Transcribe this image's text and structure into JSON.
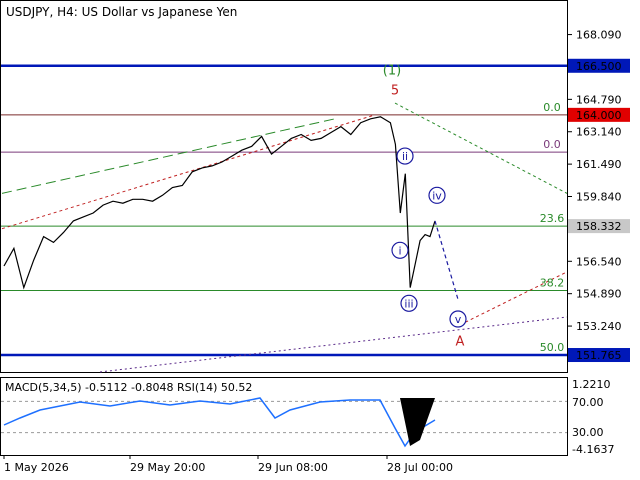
{
  "header": {
    "symbol": "USDJPY",
    "timeframe": "H4",
    "description": "US Dollar vs Japanese Yen",
    "title_text": "USDJPY, H4:  US Dollar vs Japanese Yen"
  },
  "chart_data": {
    "type": "line",
    "title": "USDJPY, H4:  US Dollar vs Japanese Yen",
    "price_ylim": [
      150.9,
      169.8
    ],
    "y_tick_labels": [
      "168.090",
      "166.500",
      "164.790",
      "164.000",
      "163.140",
      "161.490",
      "159.840",
      "158.332",
      "156.540",
      "154.890",
      "153.240",
      "151.765"
    ],
    "y_ticks": [
      168.09,
      164.79,
      163.14,
      161.49,
      159.84,
      156.54,
      154.89,
      153.24
    ],
    "x_tick_labels": [
      "1 May 2026",
      "29 May 20:00",
      "29 Jun 08:00",
      "28 Jul 00:00"
    ],
    "price_series": {
      "name": "USDJPY",
      "x": [
        0,
        10,
        20,
        30,
        40,
        50,
        60,
        70,
        80,
        90,
        100,
        110,
        120,
        130,
        140,
        150,
        160,
        170,
        180,
        190,
        200,
        210,
        220,
        230,
        240,
        250,
        260,
        270,
        280,
        290,
        300,
        310,
        320,
        330,
        340,
        350,
        360,
        370,
        380,
        390,
        395,
        400,
        405,
        410,
        415,
        420,
        425,
        430,
        435
      ],
      "y": [
        156.3,
        157.2,
        155.2,
        156.6,
        157.8,
        157.5,
        158.0,
        158.6,
        158.8,
        159.0,
        159.4,
        159.6,
        159.5,
        159.7,
        159.7,
        159.6,
        159.9,
        160.3,
        160.4,
        161.1,
        161.3,
        161.4,
        161.6,
        161.9,
        162.2,
        162.4,
        162.9,
        162.0,
        162.4,
        162.8,
        163.0,
        162.7,
        162.8,
        163.1,
        163.4,
        163.0,
        163.6,
        163.8,
        163.9,
        163.6,
        162.5,
        159.0,
        161.0,
        155.2,
        156.4,
        157.6,
        157.9,
        157.8,
        158.6
      ]
    },
    "levels": [
      {
        "price": 166.5,
        "label": "166.500",
        "color": "#0018b8",
        "style": "thick"
      },
      {
        "price": 164.0,
        "label": "164.000",
        "color": "#7a2b2b",
        "style": "solid",
        "badge_color": "#e00000"
      },
      {
        "price": 162.1,
        "label": "0.0",
        "color": "#7a3a7a",
        "style": "solid"
      },
      {
        "price": 158.332,
        "label": "158.332",
        "color": "#2a8a2a",
        "style": "solid",
        "badge_color": "#c8c8c8"
      },
      {
        "price": 155.05,
        "label": "38.2",
        "color": "#2a8a2a",
        "style": "solid"
      },
      {
        "price": 151.765,
        "label": "151.765",
        "color": "#0018b8",
        "style": "thick"
      }
    ],
    "fib_labels": [
      {
        "text": "0.0",
        "price": 164.0,
        "color": "#2a8a2a"
      },
      {
        "text": "0.0",
        "price": 162.1,
        "color": "#7a3a7a"
      },
      {
        "text": "23.6",
        "price": 158.332,
        "color": "#2a8a2a"
      },
      {
        "text": "38.2",
        "price": 155.05,
        "color": "#2a8a2a"
      },
      {
        "text": "50.0",
        "price": 151.765,
        "color": "#2a8a2a"
      }
    ],
    "wave_labels": [
      {
        "text": "(1)",
        "color": "#2a8a2a",
        "style": "plain"
      },
      {
        "text": "5",
        "color": "#c02020",
        "style": "plain"
      },
      {
        "text": "ii",
        "color": "#1a1aa0",
        "style": "circle"
      },
      {
        "text": "iv",
        "color": "#1a1aa0",
        "style": "circle"
      },
      {
        "text": "i",
        "color": "#1a1aa0",
        "style": "circle"
      },
      {
        "text": "iii",
        "color": "#1a1aa0",
        "style": "circle"
      },
      {
        "text": "v",
        "color": "#1a1aa0",
        "style": "circle"
      },
      {
        "text": "A",
        "color": "#c02020",
        "style": "plain"
      }
    ],
    "macd": {
      "label": "MACD(5,34,5) -0.5112 -0.8048 RSI(14) 50.52",
      "params": "MACD(5,34,5)",
      "macd_value": -0.5112,
      "signal_value": -0.8048,
      "rsi_label": "RSI(14)",
      "rsi_value": 50.52,
      "tick_labels": [
        "1.2210",
        "70.00",
        "30.00",
        "-4.1637"
      ],
      "rsi_levels": [
        70,
        30
      ]
    },
    "grid": false
  }
}
